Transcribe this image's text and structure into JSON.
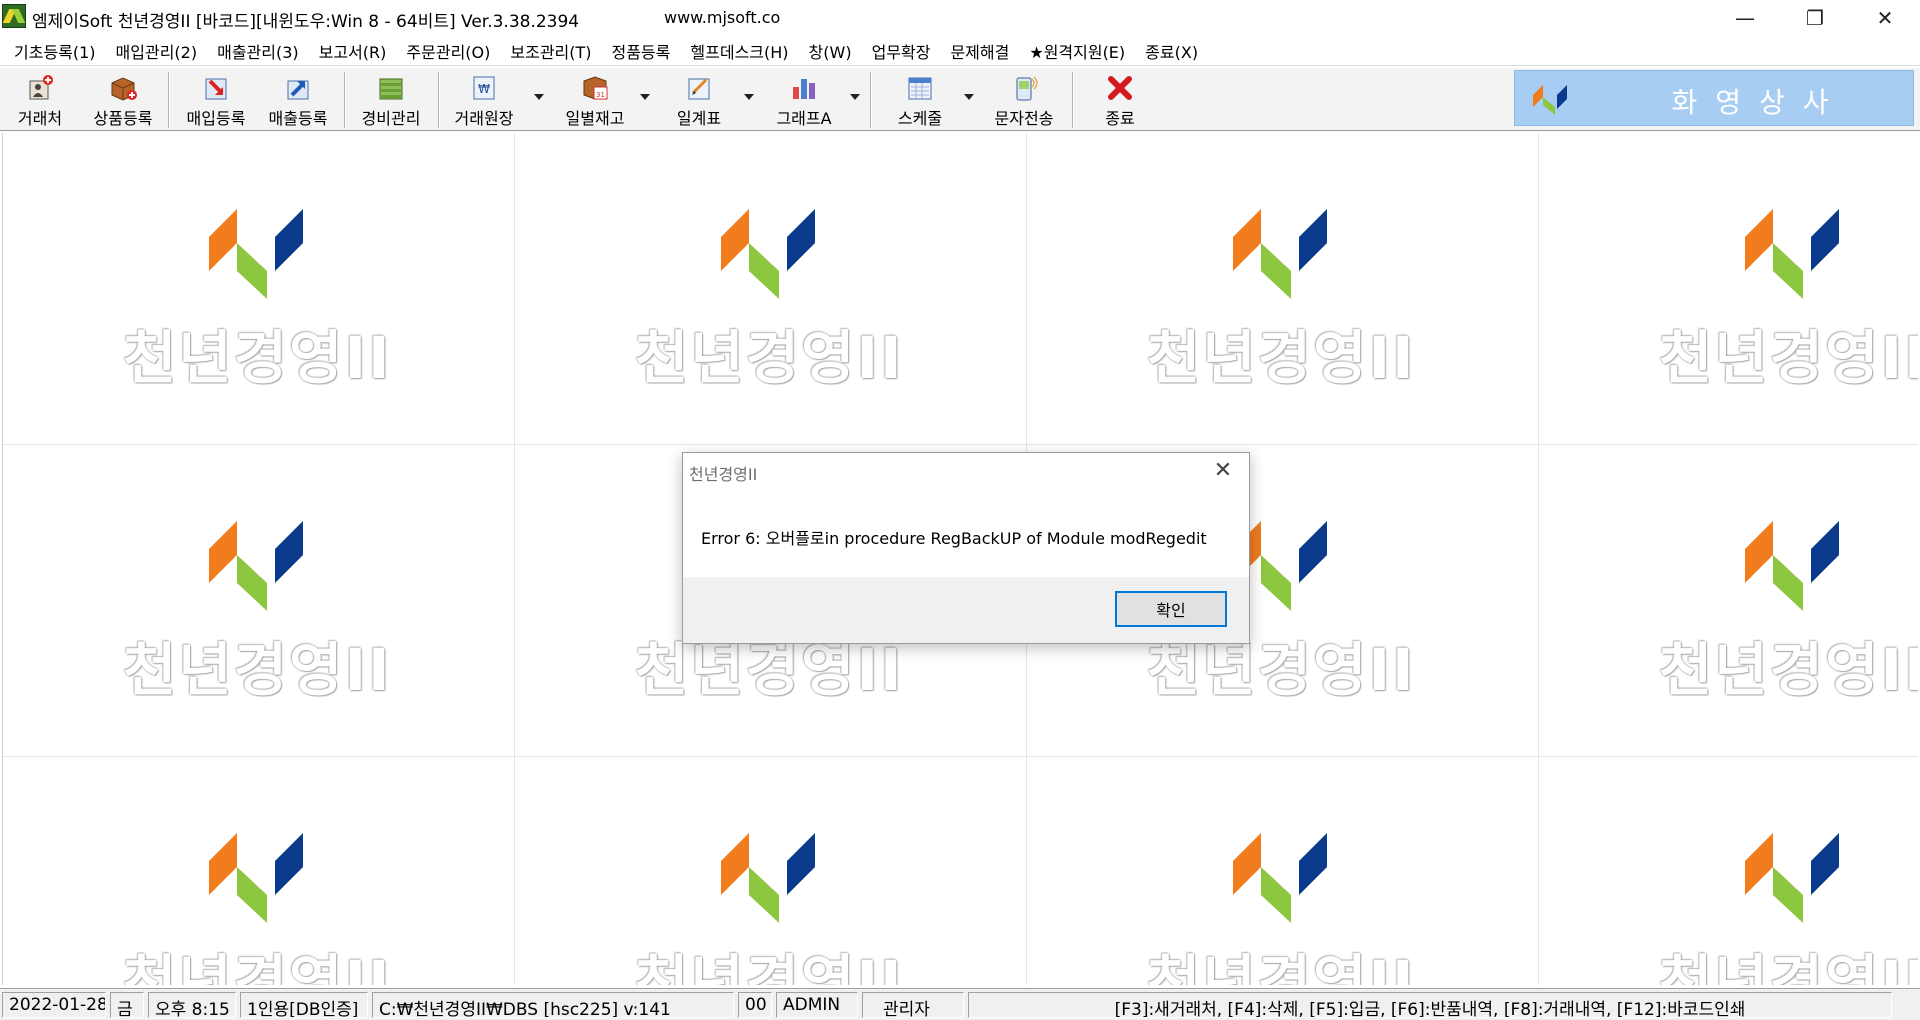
{
  "window": {
    "title": "엠제이Soft 천년경영II [바코드][내윈도우:Win 8 - 64비트] Ver.3.38.2394",
    "url": "www.mjsoft.co",
    "minimize_glyph": "—",
    "maximize_glyph": "❐",
    "close_glyph": "✕"
  },
  "menu": [
    "기초등록(1)",
    "매입관리(2)",
    "매출관리(3)",
    "보고서(R)",
    "주문관리(O)",
    "보조관리(T)",
    "정품등록",
    "헬프데스크(H)",
    "창(W)",
    "업무확장",
    "문제해결",
    "★원격지원(E)",
    "종료(X)"
  ],
  "toolbar": {
    "buttons": [
      {
        "label": "거래처",
        "icon": "customer-icon"
      },
      {
        "label": "상품등록",
        "icon": "product-icon"
      },
      {
        "label": "매입등록",
        "icon": "purchase-icon"
      },
      {
        "label": "매출등록",
        "icon": "sales-icon"
      },
      {
        "label": "경비관리",
        "icon": "expense-icon"
      },
      {
        "label": "거래원장",
        "icon": "ledger-icon"
      },
      {
        "label": "일별재고",
        "icon": "daily-stock-icon"
      },
      {
        "label": "일계표",
        "icon": "daily-report-icon"
      },
      {
        "label": "그래프A",
        "icon": "graph-icon"
      },
      {
        "label": "스케줄",
        "icon": "schedule-icon"
      },
      {
        "label": "문자전송",
        "icon": "sms-icon"
      },
      {
        "label": "종료",
        "icon": "exit-icon"
      }
    ],
    "company_name": "화영상사"
  },
  "watermark": {
    "text": "천년경영II"
  },
  "dialog": {
    "title": "천년경영II",
    "message": "Error 6: 오버플로in procedure RegBackUP of Module modRegedit",
    "ok_label": "확인",
    "close_glyph": "✕"
  },
  "status": {
    "date": "2022-01-28",
    "weekday": "금",
    "time": "오후 8:15",
    "license": "1인용[DB인증]",
    "db_path": "C:₩천년경영II₩DBS [hsc225] v:141",
    "code": "00",
    "user": "ADMIN",
    "role": "관리자",
    "shortcuts": "[F3]:새거래처, [F4]:삭제, [F5]:입금, [F6]:반품내역, [F8]:거래내역, [F12]:바코드인쇄"
  },
  "colors": {
    "logo_orange": "#f07c1e",
    "logo_green": "#8dc63f",
    "logo_blue": "#0b3a8c",
    "banner": "#a8cdf3",
    "dialog_ok_border": "#0078d7"
  }
}
